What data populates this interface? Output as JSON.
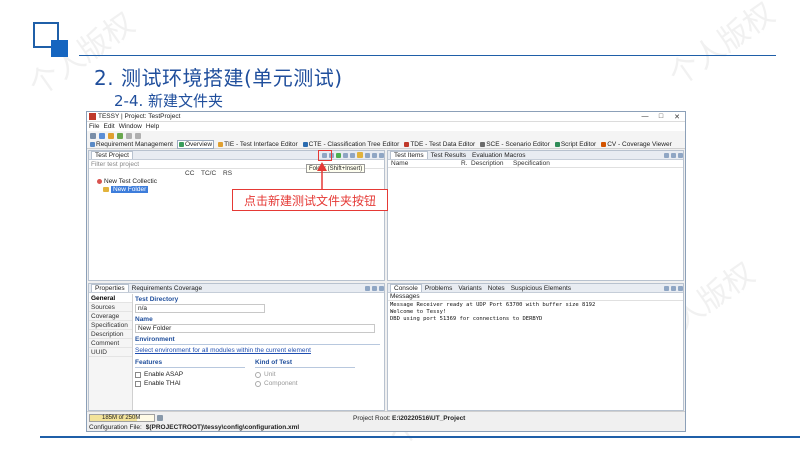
{
  "slide": {
    "title": "2. 测试环境搭建(单元测试)",
    "subtitle": "2-4. 新建文件夹",
    "watermark": "个人版权"
  },
  "app": {
    "title": "TESSY | Project: TestProject",
    "window_buttons": [
      "—",
      "□",
      "✕"
    ],
    "menu": [
      "File",
      "Edit",
      "Window",
      "Help"
    ],
    "perspectives": [
      {
        "label": "Requirement Management",
        "icon": "requirements-icon",
        "active": false
      },
      {
        "label": "Overview",
        "icon": "overview-icon",
        "active": true
      },
      {
        "label": "TIE - Test Interface Editor",
        "icon": "tie-icon",
        "active": false
      },
      {
        "label": "CTE - Classification Tree Editor",
        "icon": "cte-icon",
        "active": false
      },
      {
        "label": "TDE - Test Data Editor",
        "icon": "tde-icon",
        "active": false
      },
      {
        "label": "SCE - Scenario Editor",
        "icon": "sce-icon",
        "active": false
      },
      {
        "label": "Script Editor",
        "icon": "script-icon",
        "active": false
      },
      {
        "label": "CV - Coverage Viewer",
        "icon": "cv-icon",
        "active": false
      }
    ],
    "test_project": {
      "tab": "Test Project",
      "filter_placeholder": "Filter test project",
      "columns": [
        "CC",
        "TC/C",
        "RS"
      ],
      "tree": [
        {
          "label": "New Test Collectic",
          "selected": false
        },
        {
          "label": "New Folder",
          "selected": true
        }
      ],
      "tooltip": "Folder (Shift+Insert)"
    },
    "callout": "点击新建测试文件夹按钮",
    "test_items": {
      "tabs": [
        "Test Items",
        "Test Results",
        "Evaluation Macros"
      ],
      "columns": [
        "Name",
        "R.",
        "Description",
        "Specification"
      ]
    },
    "properties": {
      "tabs": [
        "Properties",
        "Requirements Coverage"
      ],
      "side_tabs": [
        "General",
        "Sources",
        "Coverage",
        "Specification",
        "Description",
        "Comment",
        "UUID"
      ],
      "test_directory_label": "Test Directory",
      "test_directory_value": "n/a",
      "name_label": "Name",
      "name_value": "New Folder",
      "environment_label": "Environment",
      "environment_link": "Select environment for all modules within the current element",
      "features_label": "Features",
      "features": [
        "Enable ASAP",
        "Enable THAI"
      ],
      "kind_label": "Kind of Test",
      "kinds": [
        "Unit",
        "Component"
      ]
    },
    "console": {
      "tabs": [
        "Console",
        "Problems",
        "Variants",
        "Notes",
        "Suspicious Elements"
      ],
      "header": "Messages",
      "lines": [
        "Message Receiver ready at UDP Port 63700 with buffer size 8192",
        "Welcome to Tessy!",
        "DBD using port 51369 for connections to DERBYD"
      ]
    },
    "status": {
      "memory": "185M of 250M",
      "memory_fraction": 0.74,
      "project_root_label": "Project Root:",
      "project_root_value": "E:\\20220516\\UT_Project",
      "config_label": "Configuration File:",
      "config_value": "$(PROJECTROOT)\\tessy\\config\\configuration.xml"
    }
  }
}
